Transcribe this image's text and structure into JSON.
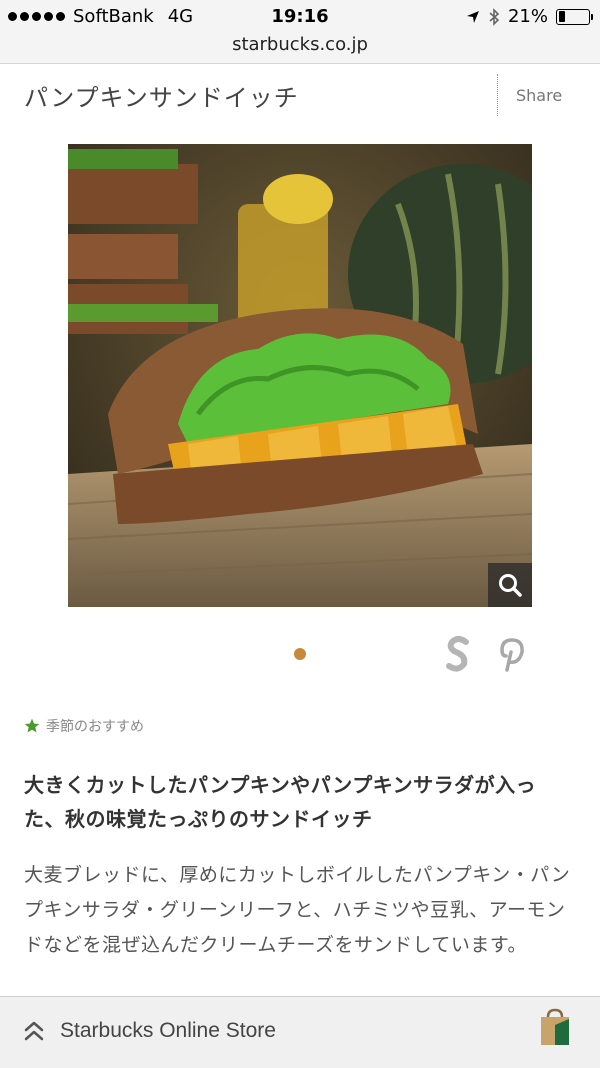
{
  "status_bar": {
    "carrier": "SoftBank",
    "network": "4G",
    "time": "19:16",
    "battery": "21%",
    "battery_level": 0.21
  },
  "url_bar": {
    "domain": "starbucks.co.jp"
  },
  "header": {
    "title": "パンプキンサンドイッチ",
    "share_label": "Share"
  },
  "product_image": {
    "alt_icon": "zoom-icon"
  },
  "carousel": {
    "current": 1,
    "total": 1
  },
  "category": {
    "label": "季節のおすすめ",
    "icon": "star-icon",
    "icon_color": "#4a9a2c"
  },
  "headline": "大きくカットしたパンプキンやパンプキンサラダが入った、秋の味覚たっぷりのサンドイッチ",
  "description": "大麦ブレッドに、厚めにカットしボイルしたパンプキン・パンプキンサラダ・グリーンリーフと、ハチミツや豆乳、アーモンドなどを混ぜ込んだクリームチーズをサンドしています。",
  "bottom_bar": {
    "label": "Starbucks Online Store"
  },
  "colors": {
    "accent_dot": "#c9893a",
    "brand_green": "#00704a"
  }
}
